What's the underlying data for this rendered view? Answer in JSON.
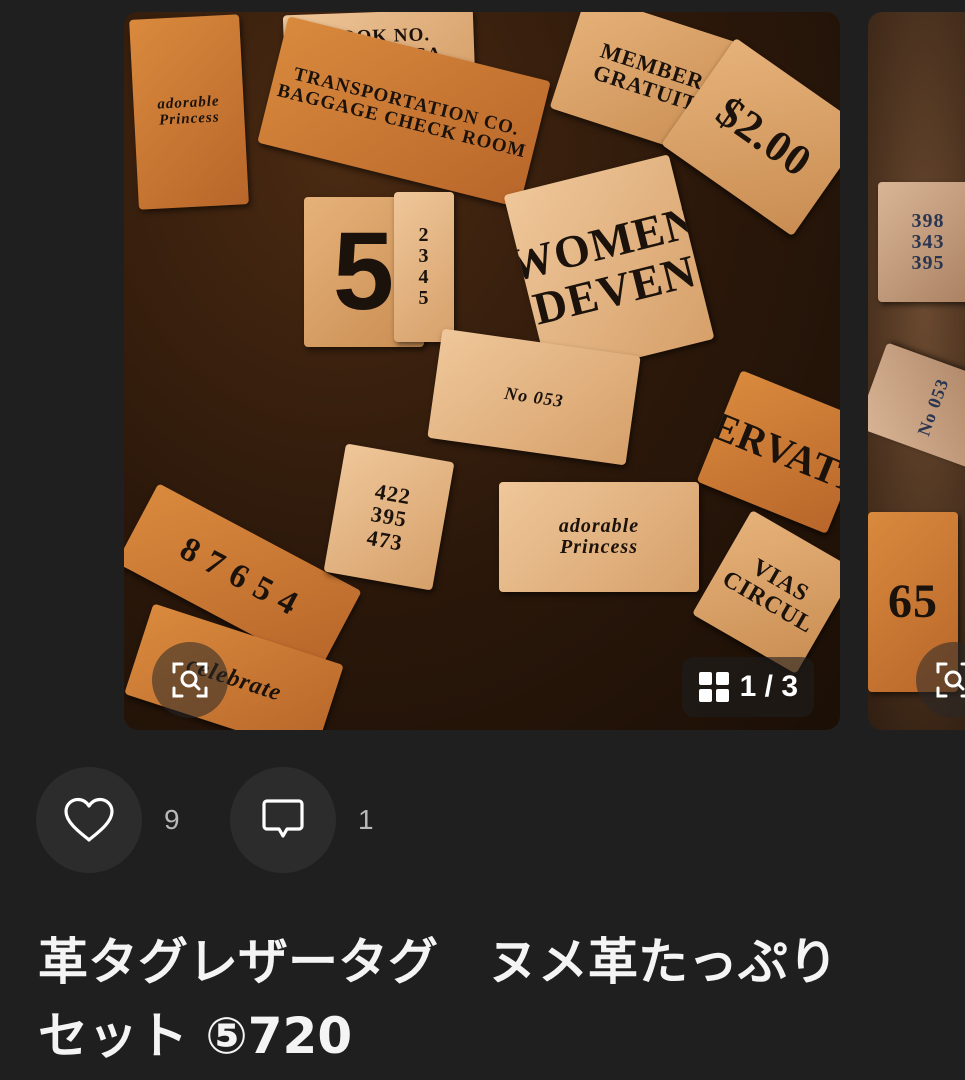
{
  "gallery": {
    "counter": "1 / 3",
    "main_image": {
      "tags": [
        {
          "text": "BOOK NO.\nCLASSIFICA"
        },
        {
          "text": "TRANSPORTATION CO.\nBAGGAGE CHECK ROOM"
        },
        {
          "text": "adorable\nPrincess"
        },
        {
          "text": "5"
        },
        {
          "text": "2\n3\n4\n5"
        },
        {
          "text": "MEMBER\nGRATUIT"
        },
        {
          "text": "$2.00"
        },
        {
          "text": "WOMEN\nDEVEN"
        },
        {
          "text": "ERVATI"
        },
        {
          "text": "8 7 6 5 4"
        },
        {
          "text": "adorable\nPrincess"
        },
        {
          "text": "422\n395\n473"
        },
        {
          "text": "VIAS\nCIRCUL"
        },
        {
          "text": "No 053"
        },
        {
          "text": "celebrate"
        }
      ]
    },
    "next_image": {
      "tags": [
        {
          "text": "398\n343\n395"
        },
        {
          "text": "No 053"
        },
        {
          "text": "65"
        }
      ]
    }
  },
  "actions": {
    "like_count": "9",
    "comment_count": "1"
  },
  "product": {
    "title": "革タグレザータグ　ヌメ革たっぷり\nセット ⑤720"
  },
  "icons": {
    "zoom": "zoom-search-icon",
    "gallery": "grid-icon",
    "like": "heart-icon",
    "comment": "comment-bubble-icon"
  }
}
